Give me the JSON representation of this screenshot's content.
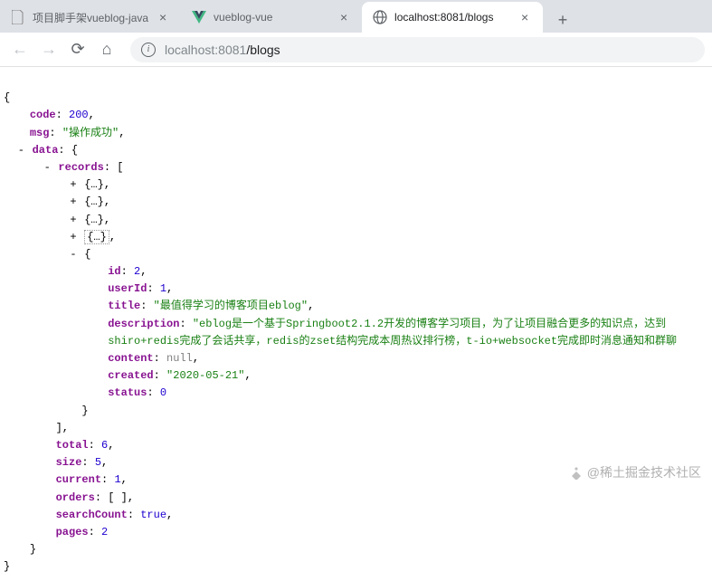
{
  "tabs": [
    {
      "title": "项目脚手架vueblog-java",
      "icon": "file"
    },
    {
      "title": "vueblog-vue",
      "icon": "vue"
    },
    {
      "title": "localhost:8081/blogs",
      "icon": "globe"
    }
  ],
  "address": {
    "host": "localhost",
    "port": ":8081",
    "path": "/blogs"
  },
  "json": {
    "code": 200,
    "msg": "\"操作成功\"",
    "data_label": "data",
    "records_label": "records",
    "collapsed_placeholder": "{…}",
    "expanded": {
      "id": 2,
      "userId": 1,
      "title": "\"最值得学习的博客项目eblog\"",
      "description": "\"eblog是一个基于Springboot2.1.2开发的博客学习项目，为了让项目融合更多的知识点，达到",
      "description_line2": "shiro+redis完成了会话共享，redis的zset结构完成本周热议排行榜，t-io+websocket完成即时消息通知和群聊",
      "content": "null",
      "created": "\"2020-05-21\"",
      "status": 0
    },
    "total": 6,
    "size": 5,
    "current": 1,
    "orders_val": "[ ]",
    "searchCount": "true",
    "pages": 2
  },
  "watermark": "@稀土掘金技术社区"
}
